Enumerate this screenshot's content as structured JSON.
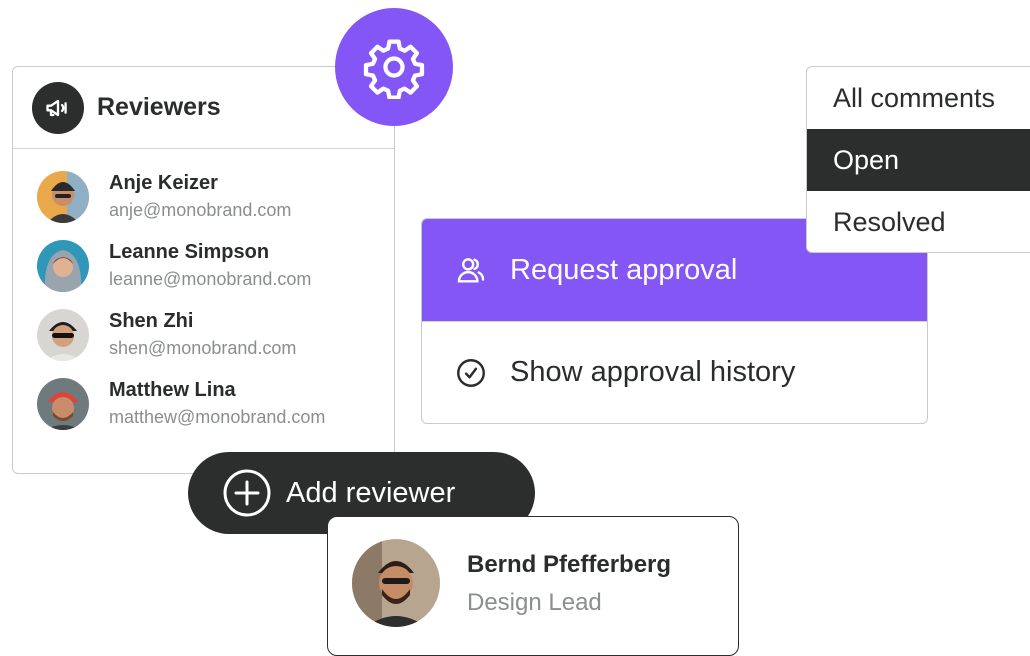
{
  "reviewers_panel": {
    "title": "Reviewers",
    "items": [
      {
        "name": "Anje Keizer",
        "email": "anje@monobrand.com"
      },
      {
        "name": "Leanne Simpson",
        "email": "leanne@monobrand.com"
      },
      {
        "name": "Shen Zhi",
        "email": "shen@monobrand.com"
      },
      {
        "name": "Matthew Lina",
        "email": "matthew@monobrand.com"
      }
    ]
  },
  "add_reviewer": {
    "label": "Add reviewer"
  },
  "approval_menu": {
    "items": [
      {
        "label": "Request approval",
        "icon": "users-icon"
      },
      {
        "label": "Show approval history",
        "icon": "check-circle-icon"
      }
    ]
  },
  "filter_menu": {
    "items": [
      "All comments",
      "Open",
      "Resolved"
    ],
    "selected": "Open"
  },
  "profile_card": {
    "name": "Bernd Pfefferberg",
    "role": "Design Lead"
  },
  "colors": {
    "accent": "#8356f5",
    "dark": "#2b2e2d",
    "muted": "#8a8e8d",
    "border": "#c9cccb"
  }
}
